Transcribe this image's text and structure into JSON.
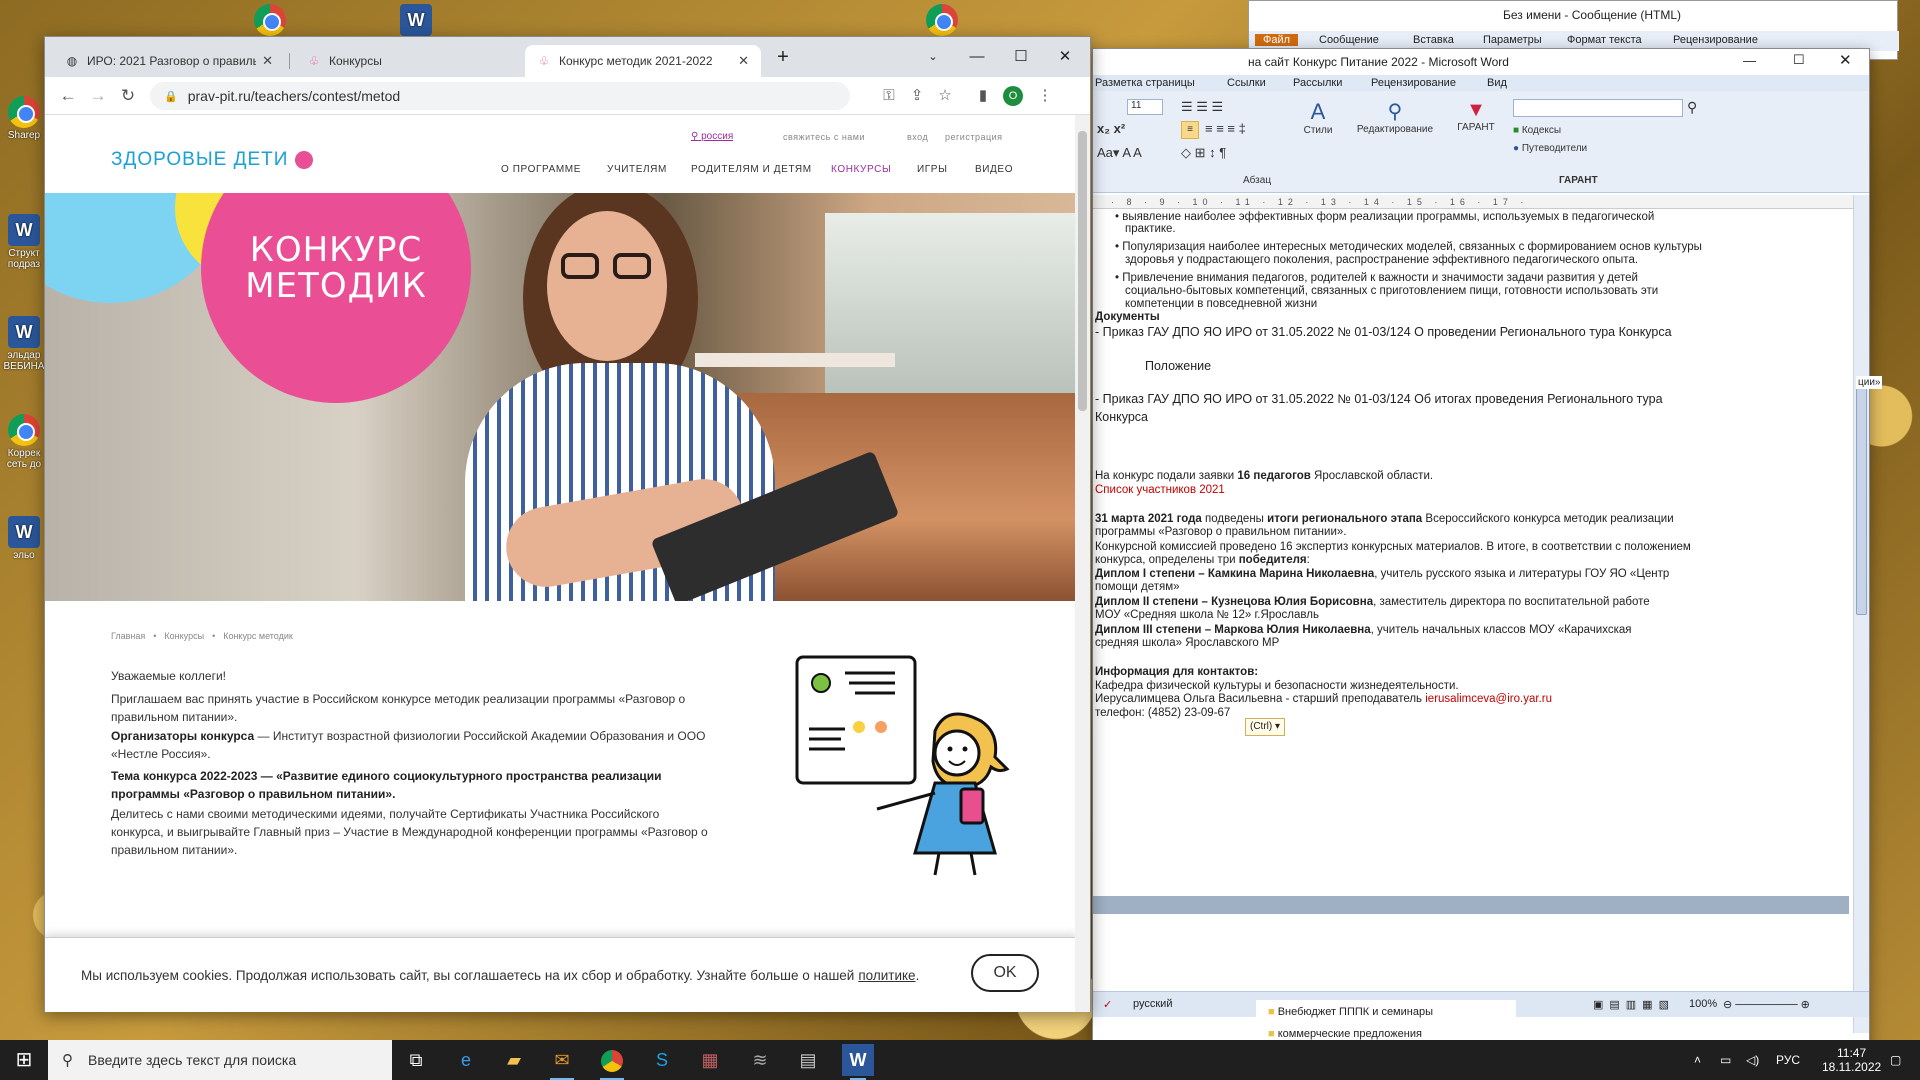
{
  "desktop": {
    "icons": [
      {
        "label": "Sharep"
      },
      {
        "label": "Структ подраз"
      },
      {
        "label": "эльдар ВЕБИНА"
      },
      {
        "label": "Коррек сеть до"
      },
      {
        "label": "эльо"
      }
    ]
  },
  "chrome": {
    "tabs": [
      {
        "title": "ИРО: 2021 Разговор о правильн..."
      },
      {
        "title": "Конкурсы"
      },
      {
        "title": "Конкурс методик 2021-2022"
      }
    ],
    "new_tab": "+",
    "url": "prav-pit.ru/teachers/contest/metod",
    "profile_initial": "O"
  },
  "site": {
    "logo": "ЗДОРОВЫЕ ДЕТИ",
    "region": "россия",
    "contact": "свяжитесь с нами",
    "login": "вход",
    "register": "регистрация",
    "menu": [
      "О ПРОГРАММЕ",
      "УЧИТЕЛЯМ",
      "РОДИТЕЛЯМ И ДЕТЯМ",
      "КОНКУРСЫ",
      "ИГРЫ",
      "ВИДЕО"
    ],
    "hero_line1": "КОНКУРС",
    "hero_line2": "МЕТОДИК",
    "breadcrumbs": [
      "Главная",
      "Конкурсы",
      "Конкурс методик"
    ],
    "greeting": "Уважаемые коллеги!",
    "invite": "Приглашаем вас принять участие в Российском конкурсе методик реализации программы «Разговор о правильном питании».",
    "org_label": "Организаторы конкурса",
    "org_text": " — Институт возрастной физиологии Российской Академии Образования и ООО «Нестле Россия».",
    "theme": "Тема конкурса 2022-2023 — «Развитие единого социокультурного пространства реализации программы «Разговор о правильном питании».",
    "share": "Делитесь с нами своими методическими идеями, получайте Сертификаты Участника Российского конкурса, и выигрывайте Главный приз – Участие в Международной конференции программы «Разговор о правильном питании».",
    "cookie_text": "Мы используем cookies. Продолжая использовать сайт, вы соглашаетесь на их сбор и обработку. Узнайте больше о нашей",
    "cookie_link": "политике",
    "cookie_ok": "OK"
  },
  "word": {
    "title": "на сайт Конкурс Питание 2022 - Microsoft Word",
    "behind_title": "Без имени - Сообщение (HTML)",
    "behind_tabs": [
      "Файл",
      "Сообщение",
      "Вставка",
      "Параметры",
      "Формат текста",
      "Рецензирование"
    ],
    "tabs": [
      "Разметка страницы",
      "Ссылки",
      "Рассылки",
      "Рецензирование",
      "Вид"
    ],
    "font_size": "11",
    "ribbon_styles": "Стили",
    "ribbon_edit": "Редактирование",
    "ribbon_garant": "ГАРАНТ",
    "ribbon_kodeks": "Кодексы",
    "ribbon_putev": "Путеводители",
    "group_para": "Абзац",
    "group_garant": "ГАРАНТ",
    "ruler": "· 8 · 9 · 10 · 11 · 12 · 13 · 14 · 15 · 16 · 17 ·",
    "lines": {
      "b0": "выявление наиболее эффективных форм реализации программы, используемых в педагогической",
      "b0b": "практике.",
      "b1": "Популяризация наиболее интересных методических моделей, связанных с формированием основ культуры",
      "b1b": "здоровья у подрастающего поколения, распространение эффективного педагогического опыта.",
      "b2": "Привлечение внимания педагогов, родителей к важности и значимости задачи развития у детей",
      "b2b": "социально-бытовых компетенций, связанных с приготовлением пищи, готовности использовать эти",
      "b2c": "компетенции в повседневной жизни",
      "docs": "Документы",
      "order1": "- Приказ ГАУ ДПО ЯО ИРО от 31.05.2022  № 01-03/124  О проведении Регионального тура Конкурса",
      "polozh": "Положение",
      "order2": "- Приказ ГАУ ДПО ЯО ИРО от 31.05.2022  № 01-03/124  Об итогах проведения Регионального тура",
      "order2b": "Конкурса",
      "apps1": "На конкурс подали заявки ",
      "apps2": "16 педагогов",
      "apps3": " Ярославской области.",
      "list": "Список участников 2021",
      "mar1": "31 марта 2021 года",
      "mar2": " подведены ",
      "mar3": "итоги регионального этапа",
      "mar4": " Всероссийского конкурса методик реализации",
      "mar5": "программы «Разговор о правильном питании».",
      "com1": "Конкурсной комиссией проведено 16 экспертиз конкурсных материалов. В итоге, в соответствии с положением",
      "com2": "конкурса, определены три ",
      "com3": "победителя",
      "com4": ":",
      "d1a": "Диплом I степени – Камкина  Марина Николаевна",
      "d1b": ", учитель русского языка и литературы ГОУ ЯО «Центр",
      "d1c": "помощи детям»",
      "d2a": "Диплом II степени – Кузнецова  Юлия Борисовна",
      "d2b": ", заместитель директора по воспитательной работе",
      "d2c": "МОУ «Средняя школа № 12» г.Ярославль",
      "d3a": "Диплом III степени – Маркова Юлия Николаевна",
      "d3b": ",  учитель начальных классов МОУ «Карачихская",
      "d3c": "средняя школа» Ярославского МР",
      "info": "Информация для контактов:",
      "kaf": "Кафедра физической культуры и безопасности жизнедеятельности.",
      "ierus": "Иерусалимцева Ольга Васильевна - старший преподаватель ",
      "email": "ierusalimceva@iro.yar.ru",
      "phone": "телефон: (4852) 23-09-67",
      "ctrl": "(Ctrl) ▾"
    },
    "status_lang": "русский",
    "zoom": "100%",
    "folder1": "Внебюджет ПППК и семинары",
    "folder2": "коммерческие предложения",
    "side_fragment": "ции»"
  },
  "taskbar": {
    "search_placeholder": "Введите здесь текст для поиска",
    "lang": "РУС",
    "time": "11:47",
    "date": "18.11.2022"
  },
  "colors": {
    "accent_pink": "#ea4f95",
    "accent_blue": "#7dd3f2",
    "accent_yellow": "#f8e23c",
    "menu_active": "#9a2ea0"
  }
}
